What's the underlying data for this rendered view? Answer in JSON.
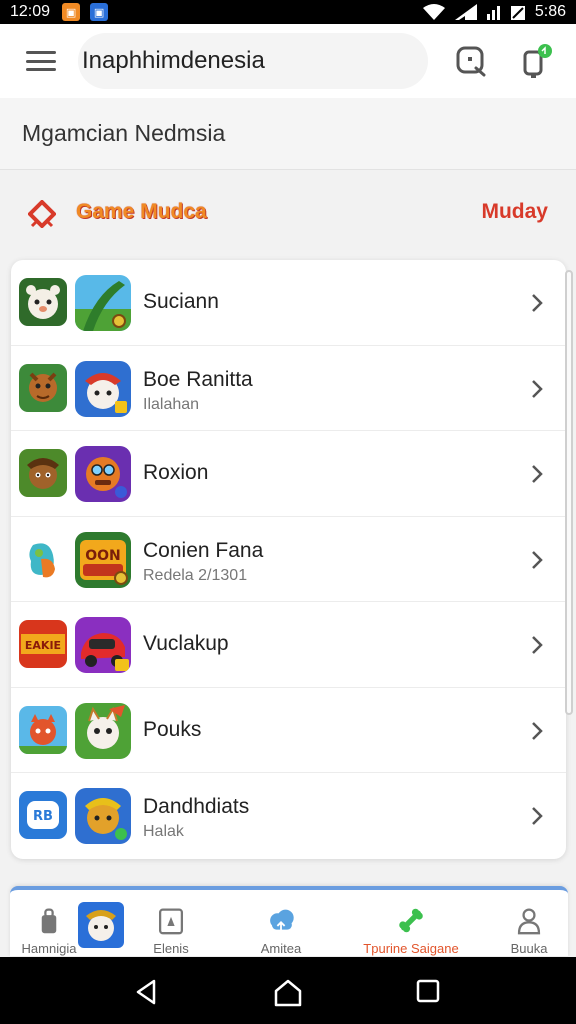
{
  "status_bar": {
    "time": "12:09",
    "battery": "5:86"
  },
  "app_bar": {
    "title": "Inaphhimdenesia"
  },
  "sub_header": {
    "text": "Mgamcian Nedmsia"
  },
  "section": {
    "title": "Game Mudca",
    "link": "Muday"
  },
  "list": [
    {
      "title": "Suciann",
      "subtitle": ""
    },
    {
      "title": "Boe Ranitta",
      "subtitle": "Ilalahan"
    },
    {
      "title": "Roxion",
      "subtitle": ""
    },
    {
      "title": "Conien Fana",
      "subtitle": "Redela 2/1301"
    },
    {
      "title": "Vuclakup",
      "subtitle": ""
    },
    {
      "title": "Pouks",
      "subtitle": ""
    },
    {
      "title": "Dandhdiats",
      "subtitle": "Halak"
    }
  ],
  "thumb_text": {
    "eakie": "EAKIE",
    "oon": "OON",
    "rb": "RB"
  },
  "bottom_nav": [
    {
      "label": "Hamnigia",
      "icon": "bag-icon"
    },
    {
      "label": "Elenis",
      "icon": "avatar-thumb"
    },
    {
      "label": "Amitea",
      "icon": "cloud-icon"
    },
    {
      "label": "Tpurine Saigane",
      "icon": "bone-icon"
    },
    {
      "label": "Buuka",
      "icon": "person-icon"
    }
  ],
  "colors": {
    "accent": "#f08a24",
    "link": "#d83a2a",
    "nav_border": "#6b9de0"
  }
}
